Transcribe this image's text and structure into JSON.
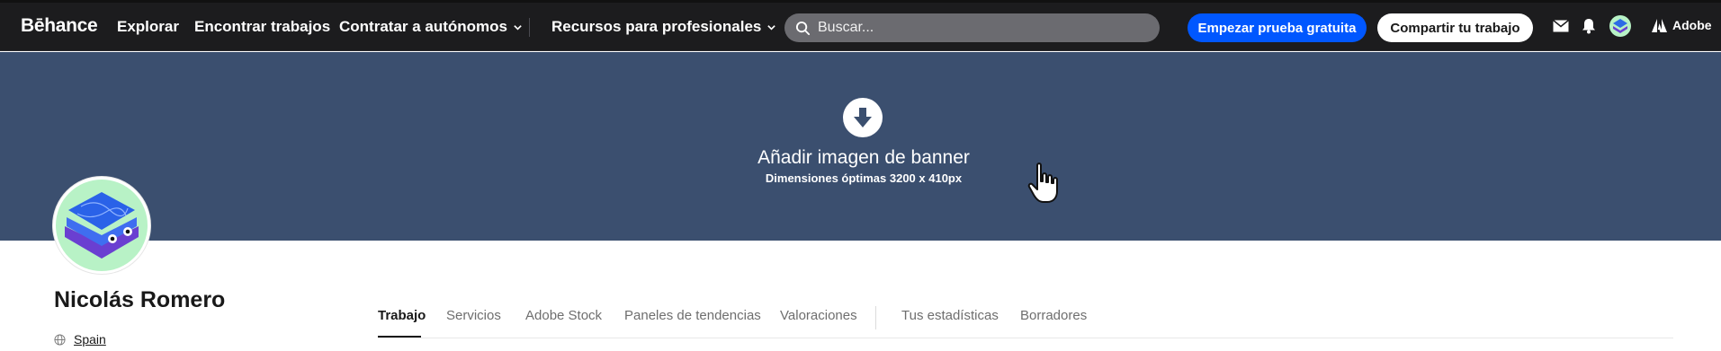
{
  "brand": {
    "logo_text": "Bēhance"
  },
  "nav": {
    "explore": "Explorar",
    "find_jobs": "Encontrar trabajos",
    "hire": "Contratar a autónomos",
    "resources": "Recursos para profesionales"
  },
  "search": {
    "placeholder": "Buscar..."
  },
  "actions": {
    "trial": "Empezar prueba gratuita",
    "share": "Compartir tu trabajo",
    "adobe": "Adobe"
  },
  "icons": {
    "mail": "mail-icon",
    "bell": "bell-icon",
    "avatar": "user-avatar",
    "adobe": "adobe-logo-icon",
    "download": "download-arrow-icon",
    "globe": "globe-icon",
    "cursor": "hand-pointer-icon"
  },
  "banner": {
    "title": "Añadir imagen de banner",
    "subtitle": "Dimensiones óptimas 3200 x 410px"
  },
  "profile": {
    "name": "Nicolás Romero",
    "location": "Spain"
  },
  "tabs": [
    {
      "label": "Trabajo",
      "active": true
    },
    {
      "label": "Servicios",
      "active": false
    },
    {
      "label": "Adobe Stock",
      "active": false
    },
    {
      "label": "Paneles de tendencias",
      "active": false
    },
    {
      "label": "Valoraciones",
      "active": false
    },
    {
      "label": "Tus estadísticas",
      "active": false
    },
    {
      "label": "Borradores",
      "active": false
    }
  ],
  "colors": {
    "nav_bg": "#1c1c1e",
    "banner_bg": "#3b4f6f",
    "accent": "#0057ff"
  }
}
